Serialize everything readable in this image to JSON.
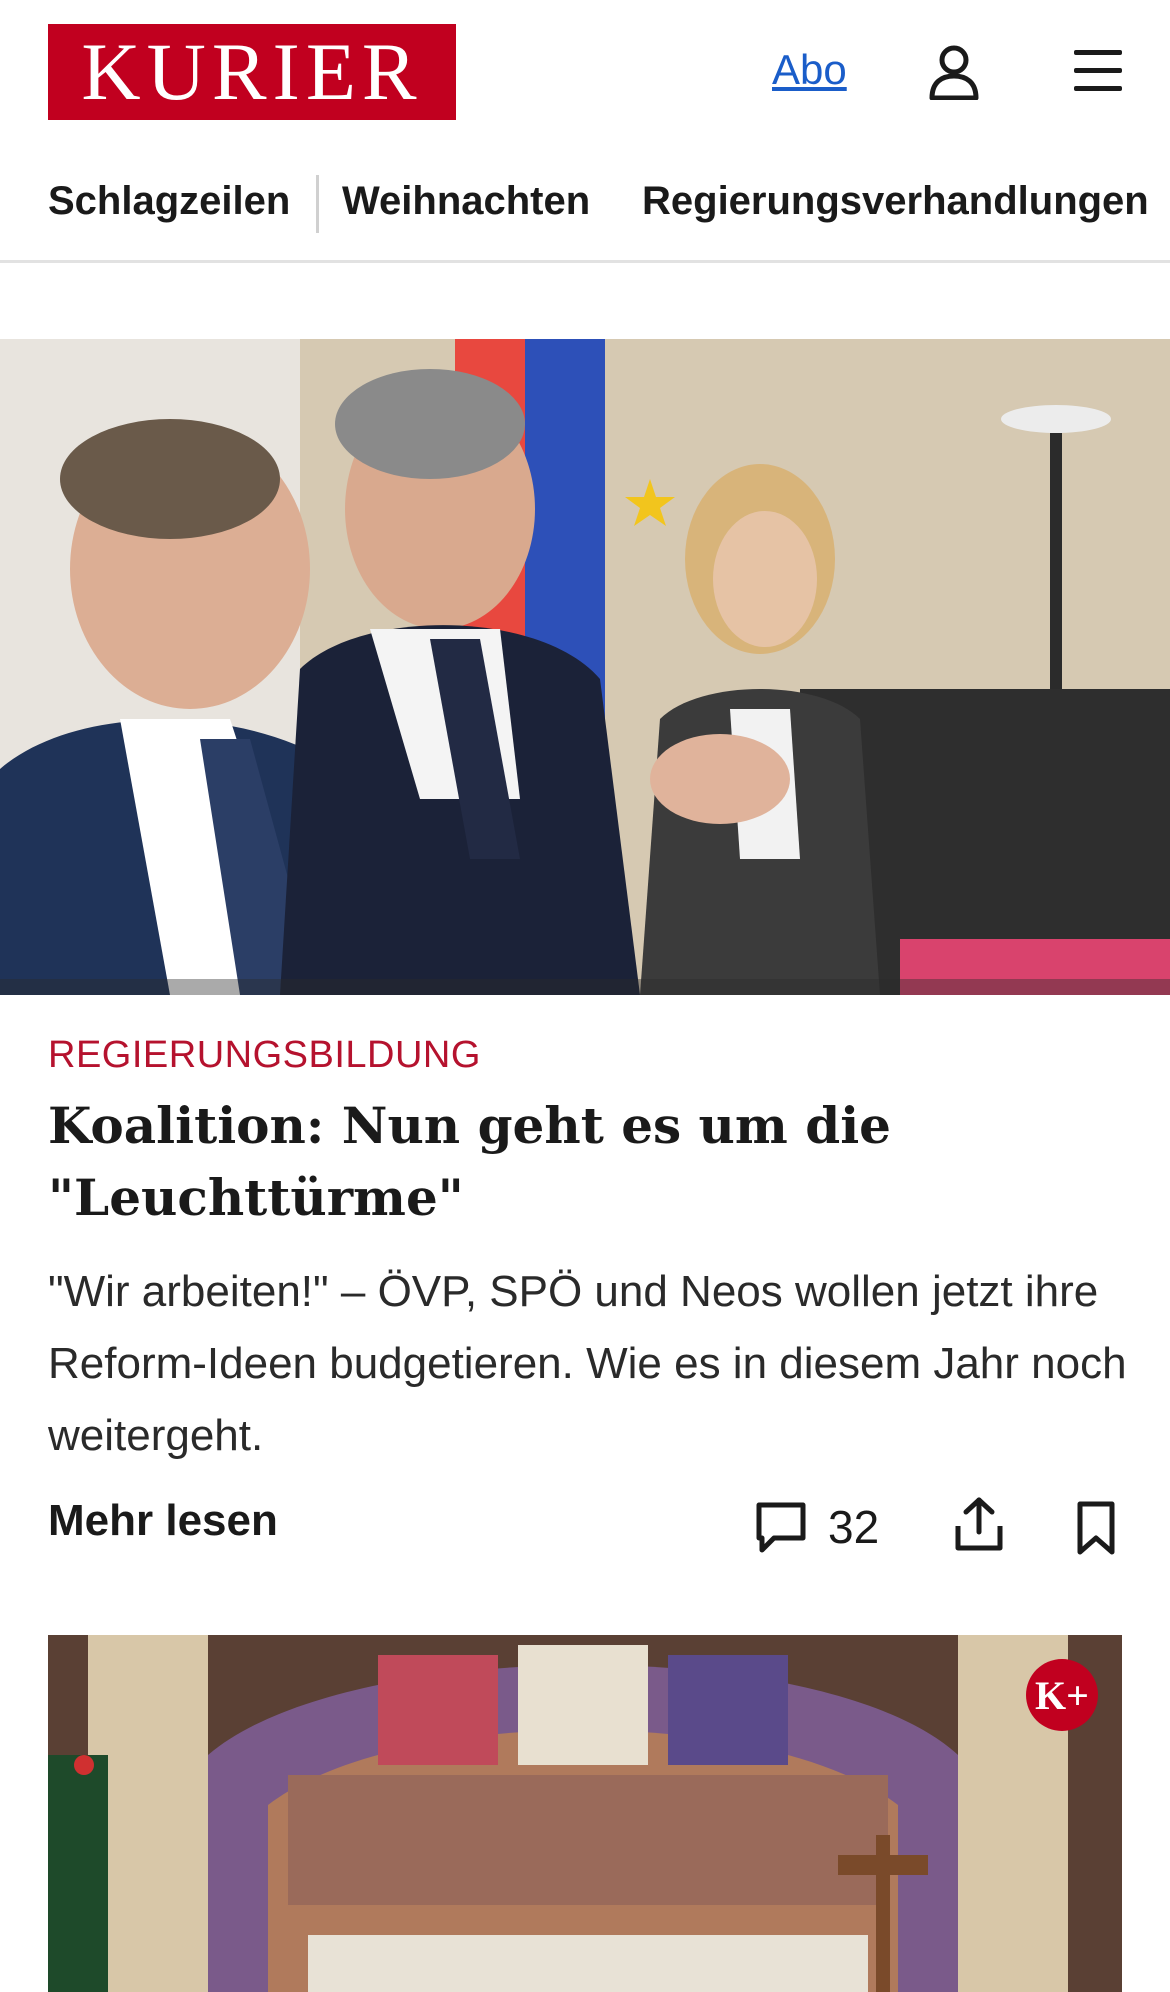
{
  "header": {
    "logo_text": "KURIER",
    "abo_label": "Abo",
    "brand_color": "#c1001f"
  },
  "nav": {
    "items": [
      "Schlagzeilen",
      "Weihnachten",
      "Regierungsverhandlungen"
    ]
  },
  "article": {
    "kicker": "REGIERUNGSBILDUNG",
    "headline": "Koalition: Nun geht es um die \"Leuchttürme\"",
    "teaser": "\"Wir arbeiten!\" – ÖVP, SPÖ und Neos wollen jetzt ihre Reform-Ideen budgetieren. Wie es in diesem Jahr noch weitergeht.",
    "more_label": "Mehr lesen",
    "comment_count": "32",
    "kicker_color": "#b5122e"
  },
  "second_article": {
    "badge": "K+"
  },
  "icons": [
    "user-icon",
    "menu-icon",
    "comment-icon",
    "share-icon",
    "bookmark-icon"
  ]
}
